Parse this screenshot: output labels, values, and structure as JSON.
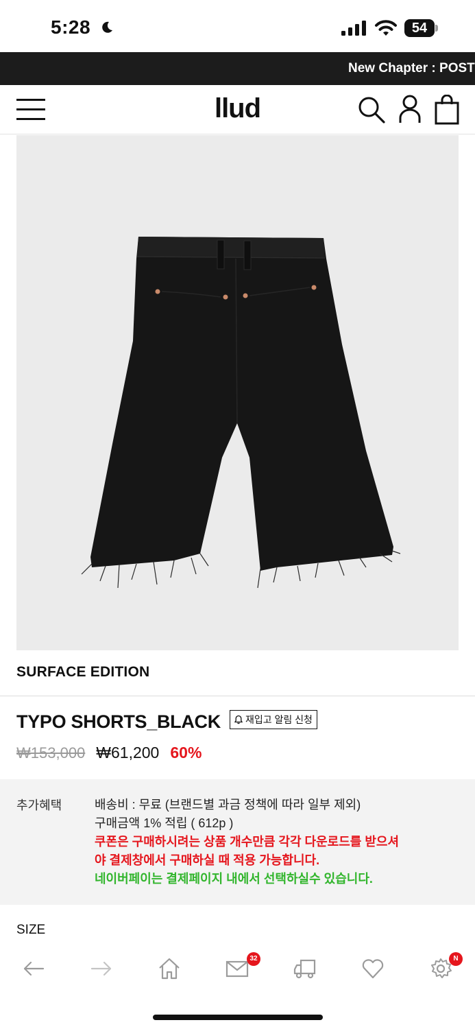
{
  "status_bar": {
    "time": "5:28",
    "battery": "54"
  },
  "announcement": {
    "text": "New Chapter : POSTL"
  },
  "header": {
    "logo": "llud"
  },
  "product": {
    "brand": "SURFACE EDITION",
    "title": "TYPO SHORTS_BLACK",
    "restock_button": "재입고 알림 신청",
    "price_original": "₩153,000",
    "price_sale": "₩61,200",
    "discount": "60%",
    "image_alt": "black shorts back view"
  },
  "benefits": {
    "label": "추가혜택",
    "shipping": "배송비 : 무료 (브랜드별 과금 정책에 따라 일부 제외)",
    "points": "구매금액 1% 적립 ( 612p )",
    "coupon_notice_1": "쿠폰은 구매하시려는 상품 개수만큼 각각 다운로드를 받으셔",
    "coupon_notice_2": "야 결제창에서 구매하실 때 적용 가능합니다.",
    "naverpay_notice": "네이버페이는 결제페이지 내에서 선택하실수 있습니다."
  },
  "options": {
    "size_label": "SIZE"
  },
  "bottom_nav": {
    "mail_badge": "32",
    "settings_badge": "N",
    "items": [
      "back-arrow-icon",
      "forward-arrow-icon",
      "home-icon",
      "mail-icon",
      "delivery-truck-icon",
      "heart-icon",
      "gear-icon"
    ]
  },
  "colors": {
    "accent_red": "#e5161d",
    "accent_green": "#31b52c",
    "announcement_bg": "#1c1c1c",
    "image_bg": "#ebebeb"
  }
}
